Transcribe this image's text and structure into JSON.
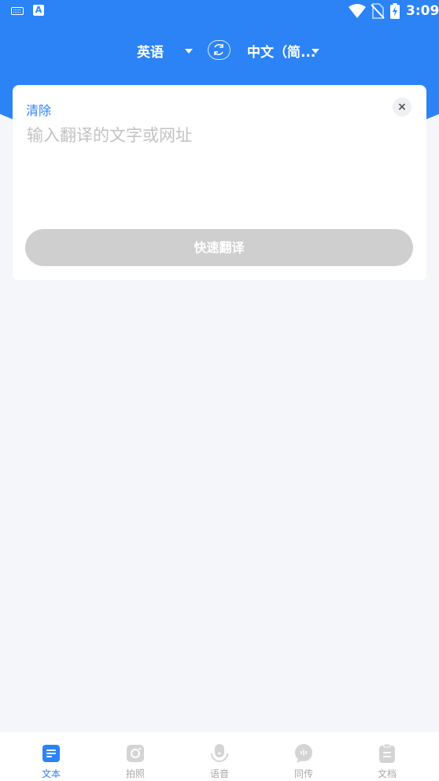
{
  "status_bar": {
    "time": "3:09",
    "keyboard_icon": "keyboard-icon",
    "notification_icon": "a-letter-icon",
    "wifi_icon": "wifi-icon",
    "signal_icon": "no-sim-icon",
    "battery_icon": "battery-charging-icon"
  },
  "language_bar": {
    "source_language": "英语",
    "target_language": "中文（简...",
    "swap_icon": "swap-icon"
  },
  "input_card": {
    "clear_label": "清除",
    "close_icon": "close-icon",
    "close_glyph": "×",
    "placeholder": "输入翻译的文字或网址",
    "value": "",
    "translate_button": "快速翻译"
  },
  "bottom_nav": {
    "items": [
      {
        "label": "文本",
        "icon": "document-text-icon",
        "active": true
      },
      {
        "label": "拍照",
        "icon": "camera-icon",
        "active": false
      },
      {
        "label": "语音",
        "icon": "microphone-icon",
        "active": false
      },
      {
        "label": "同传",
        "icon": "chat-bubble-icon",
        "active": false
      },
      {
        "label": "文档",
        "icon": "clipboard-icon",
        "active": false
      }
    ]
  },
  "colors": {
    "accent": "#2b83f6",
    "background": "#f4f6f9",
    "disabled_button": "#cfcfcf",
    "inactive_nav": "#a9a9a9"
  }
}
